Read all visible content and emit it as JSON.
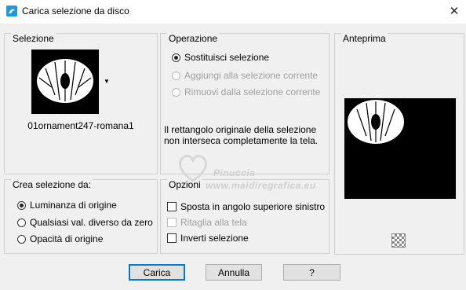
{
  "window": {
    "title": "Carica selezione da disco",
    "close_glyph": "✕"
  },
  "selezione": {
    "label": "Selezione",
    "file_name": "01ornament247-romana1"
  },
  "operazione": {
    "label": "Operazione",
    "options": [
      {
        "label": "Sostituisci selezione",
        "checked": true,
        "enabled": true
      },
      {
        "label": "Aggiungi alla selezione corrente",
        "checked": false,
        "enabled": false
      },
      {
        "label": "Rimuovi dalla selezione corrente",
        "checked": false,
        "enabled": false
      }
    ],
    "message": "Il rettangolo originale della selezione non interseca completamente la tela."
  },
  "anteprima": {
    "label": "Anteprima"
  },
  "crea": {
    "label": "Crea selezione da:",
    "options": [
      {
        "label": "Luminanza di origine",
        "checked": true
      },
      {
        "label": "Qualsiasi val. diverso da zero",
        "checked": false
      },
      {
        "label": "Opacità di origine",
        "checked": false
      }
    ]
  },
  "opzioni": {
    "label": "Opzioni",
    "options": [
      {
        "label": "Sposta in angolo superiore sinistro",
        "checked": false,
        "enabled": true
      },
      {
        "label": "Ritaglia alla tela",
        "checked": false,
        "enabled": false
      },
      {
        "label": "Inverti selezione",
        "checked": false,
        "enabled": true
      }
    ]
  },
  "buttons": {
    "ok": "Carica",
    "cancel": "Annulla",
    "help": "?"
  },
  "watermark": {
    "line1": "Pinuccia",
    "line2": "www.maidiregrafica.eu"
  },
  "colors": {
    "accent": "#0078d7",
    "window_bg": "#f0f0f0"
  }
}
